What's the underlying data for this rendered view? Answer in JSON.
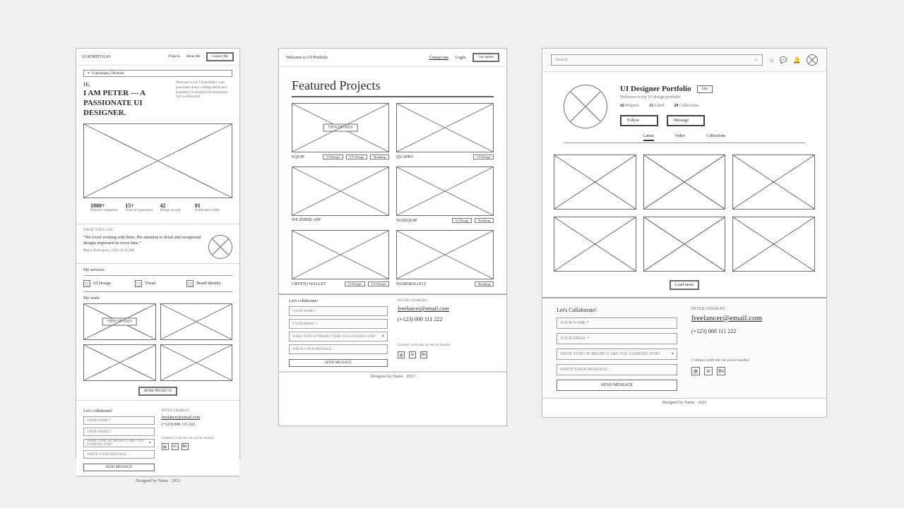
{
  "frame1": {
    "logo": "UI PORTFOLIO",
    "nav": {
      "projects": "Projects",
      "about": "About Me",
      "contact": "Contact Me"
    },
    "location_chip": "Copenhagen, Denmark",
    "hero_hi": "Hi,",
    "hero_title": "I AM PETER — A PASSIONATE UI DESIGNER.",
    "hero_copy": "Welcome to my UI portfolio! I am passionate about crafting useful and beautiful UI solutions for businesses. Let's collaborate!",
    "stats": [
      {
        "value": "1000+",
        "caption": "Projects completed"
      },
      {
        "value": "15+",
        "caption": "Years of experience"
      },
      {
        "value": "42",
        "caption": "Design awards"
      },
      {
        "value": "01",
        "caption": "Unfinished coffee"
      }
    ],
    "testimonials": {
      "heading": "WHAT THEY SAY:",
      "quote": "“We loved working with Peter. His attention to detail and exceptional designs impressed us every time.”",
      "author": "Maria Rodriguez, CEO of ACME"
    },
    "services_heading": "My services:",
    "services": [
      "UI Design",
      "Visual",
      "Brand Identity"
    ],
    "work_heading": "My work:",
    "view_details": "VIEW DETAILS",
    "more_projects": "MORE PROJECTS",
    "contact": {
      "heading": "Let's collaborate!",
      "name_ph": "YOUR NAME *",
      "email_ph": "YOUR EMAIL *",
      "select_ph": "WHAT TYPE OF PROJECT ARE YOU LOOKING FOR?",
      "message_ph": "WRITE YOUR MESSAGE…",
      "send": "SEND MESSAGE",
      "person": "PETER CHARLES",
      "email": "freelancer@email.com",
      "phone": "(+123) 000 111 222",
      "social_heading": "Connect with me on social media!"
    },
    "footer": "Designed by Name · 2023"
  },
  "frame2": {
    "welcome": "Welcome to UI Portfolio",
    "nav": {
      "contact": "Contact me",
      "login": "Login",
      "start": "Get started"
    },
    "featured_title": "Featured Projects",
    "projects": [
      {
        "name": "EQUIP",
        "tags": [
          "UI Design",
          "UX Design",
          "Branding"
        ],
        "hover": "VIEW DETAILS"
      },
      {
        "name": "QUAPPO",
        "tags": [
          "UI Design"
        ]
      },
      {
        "name": "WEATHER APP",
        "tags": []
      },
      {
        "name": "NO2EQUIP",
        "tags": [
          "UI Design",
          "Branding"
        ]
      },
      {
        "name": "CRYPTO WALLET",
        "tags": [
          "UI Design",
          "UX Design"
        ]
      },
      {
        "name": "NUMEROLOGY",
        "tags": [
          "Branding"
        ]
      }
    ],
    "contact": {
      "heading": "Let's collaborate!",
      "name_ph": "YOUR NAME *",
      "email_ph": "YOUR EMAIL *",
      "select_ph": "WHAT TYPE OF PROJECT ARE YOU LOOKING FOR?",
      "message_ph": "WRITE YOUR MESSAGE…",
      "send": "SEND MESSAGE",
      "person": "PETER CHARLES",
      "email": "freelancer@email.com",
      "phone": "(+123) 000 111 222",
      "social_heading": "Connect with me on social media!"
    },
    "footer": "Designed by Name · 2023"
  },
  "frame3": {
    "search_ph": "Search",
    "profile": {
      "title": "UI Designer Portfolio",
      "edit": "Edit",
      "subtitle": "Welcome to my UI design portfolio",
      "counters": [
        {
          "n": "42",
          "l": "Projects"
        },
        {
          "n": "12",
          "l": "Liked"
        },
        {
          "n": "28",
          "l": "Collections"
        }
      ],
      "follow": "Follow",
      "message": "Message"
    },
    "tabs": {
      "latest": "Latest",
      "video": "Video",
      "collections": "Collections"
    },
    "load_more": "Load more",
    "contact": {
      "heading": "Let's Collaborate!",
      "name_ph": "YOUR NAME *",
      "email_ph": "YOUR EMAIL *",
      "select_ph": "WHAT TYPE OF PROJECT ARE YOU LOOKING FOR?",
      "message_ph": "WRITE YOUR MESSAGE…",
      "send": "SEND MESSAGE",
      "person": "PETER CHARLES",
      "email": "freelancer@email.com",
      "phone": "(+123) 000 111 222",
      "social_heading": "Connect with me on social media!"
    },
    "footer": "Designed by Name · 2023"
  }
}
